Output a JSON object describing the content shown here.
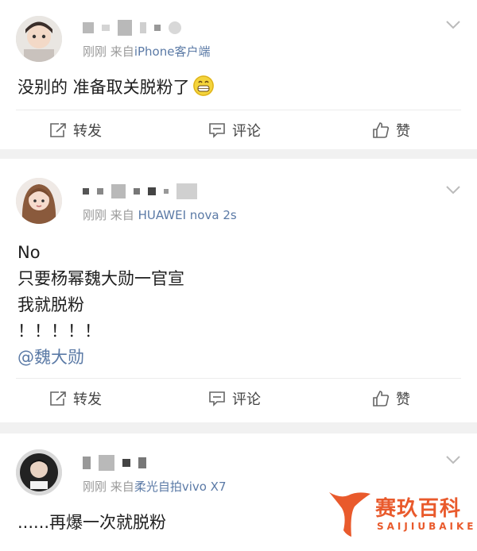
{
  "posts": [
    {
      "meta_time": "刚刚",
      "meta_from": "来自",
      "source": "iPhone客户端",
      "body": [
        "没别的 准备取关脱粉了"
      ],
      "body_emoji": "grinning-emoji",
      "actions": {
        "repost": "转发",
        "comment": "评论",
        "like": "赞"
      }
    },
    {
      "meta_time": "刚刚",
      "meta_from": "来自",
      "source": "HUAWEI nova 2s",
      "body": [
        "No",
        "只要杨幂魏大勋一官宣",
        "我就脱粉",
        "！！！！！"
      ],
      "mention": "@魏大勋",
      "actions": {
        "repost": "转发",
        "comment": "评论",
        "like": "赞"
      }
    },
    {
      "meta_time": "刚刚",
      "meta_from": "来自",
      "source": "柔光自拍vivo X7",
      "body": [
        "......再爆一次就脱粉"
      ]
    }
  ],
  "watermark": {
    "title": "赛玖百科",
    "subtitle": "SAIJIUBAIKE"
  },
  "colors": {
    "link": "#5b7aa6",
    "meta": "#9a9a9a",
    "watermark": "#e95a2c",
    "background": "#f1f1f1"
  }
}
